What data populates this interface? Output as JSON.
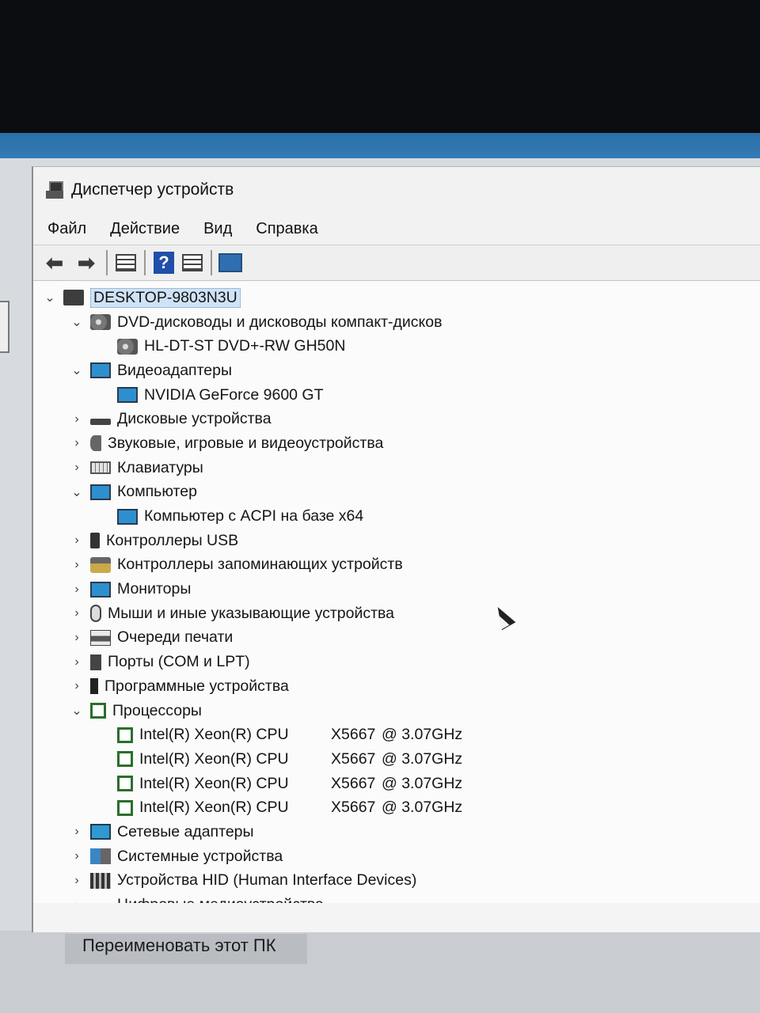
{
  "window": {
    "title": "Диспетчер устройств"
  },
  "menu": {
    "file": "Файл",
    "action": "Действие",
    "view": "Вид",
    "help": "Справка"
  },
  "toolbar": {
    "help_glyph": "?"
  },
  "tree": {
    "root": "DESKTOP-9803N3U",
    "dvd": {
      "label": "DVD-дисководы и дисководы компакт-дисков",
      "child": "HL-DT-ST DVD+-RW GH50N"
    },
    "video": {
      "label": "Видеоадаптеры",
      "child": "NVIDIA GeForce 9600 GT"
    },
    "disk": "Дисковые устройства",
    "sound": "Звуковые, игровые и видеоустройства",
    "keyboards": "Клавиатуры",
    "computer": {
      "label": "Компьютер",
      "child": "Компьютер с ACPI на базе x64"
    },
    "usb": "Контроллеры USB",
    "storage": "Контроллеры запоминающих устройств",
    "monitors": "Мониторы",
    "mice": "Мыши и иные указывающие устройства",
    "print_queues": "Очереди печати",
    "ports": "Порты (COM и LPT)",
    "software": "Программные устройства",
    "processors": {
      "label": "Процессоры",
      "items": [
        {
          "name": "Intel(R) Xeon(R) CPU",
          "model": "X5667",
          "freq": "@ 3.07GHz"
        },
        {
          "name": "Intel(R) Xeon(R) CPU",
          "model": "X5667",
          "freq": "@ 3.07GHz"
        },
        {
          "name": "Intel(R) Xeon(R) CPU",
          "model": "X5667",
          "freq": "@ 3.07GHz"
        },
        {
          "name": "Intel(R) Xeon(R) CPU",
          "model": "X5667",
          "freq": "@ 3.07GHz"
        }
      ]
    },
    "network": "Сетевые адаптеры",
    "system": "Системные устройства",
    "hid": "Устройства HID (Human Interface Devices)",
    "media": "Цифровые медиаустройства"
  },
  "background": {
    "rename_pc": "Переименовать этот ПК"
  },
  "glyphs": {
    "expanded": "⌄",
    "collapsed": "›",
    "back": "⬅",
    "forward": "➡"
  }
}
